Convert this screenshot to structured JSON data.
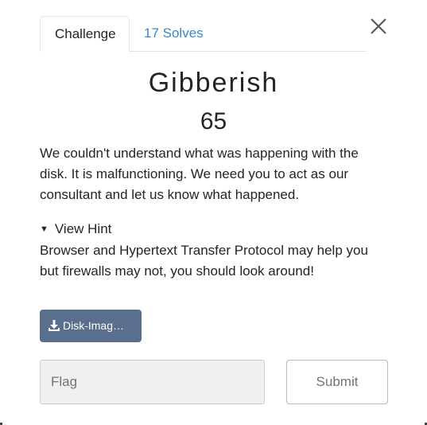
{
  "tabs": [
    {
      "label": "Challenge",
      "active": true
    },
    {
      "label": "17 Solves",
      "active": false
    }
  ],
  "close_icon": "close-icon",
  "challenge": {
    "name": "Gibberish",
    "points": "65",
    "description": "We couldn't understand what was happening with the disk. It is malfunctioning. We need you to act as our consultant and let us know what happened.",
    "hint_toggle_label": "View Hint",
    "hint_text": "Browser and Hypertext Transfer Protocol may help you but firewalls may not, you should look around!",
    "file_label": "Disk-Imag…",
    "file_icon": "download-icon"
  },
  "flag": {
    "placeholder": "Flag",
    "value": ""
  },
  "submit_label": "Submit",
  "colors": {
    "tab_link": "#3b88c7",
    "file_button": "#5a6f8e",
    "input_bg": "#f0f0f0"
  }
}
